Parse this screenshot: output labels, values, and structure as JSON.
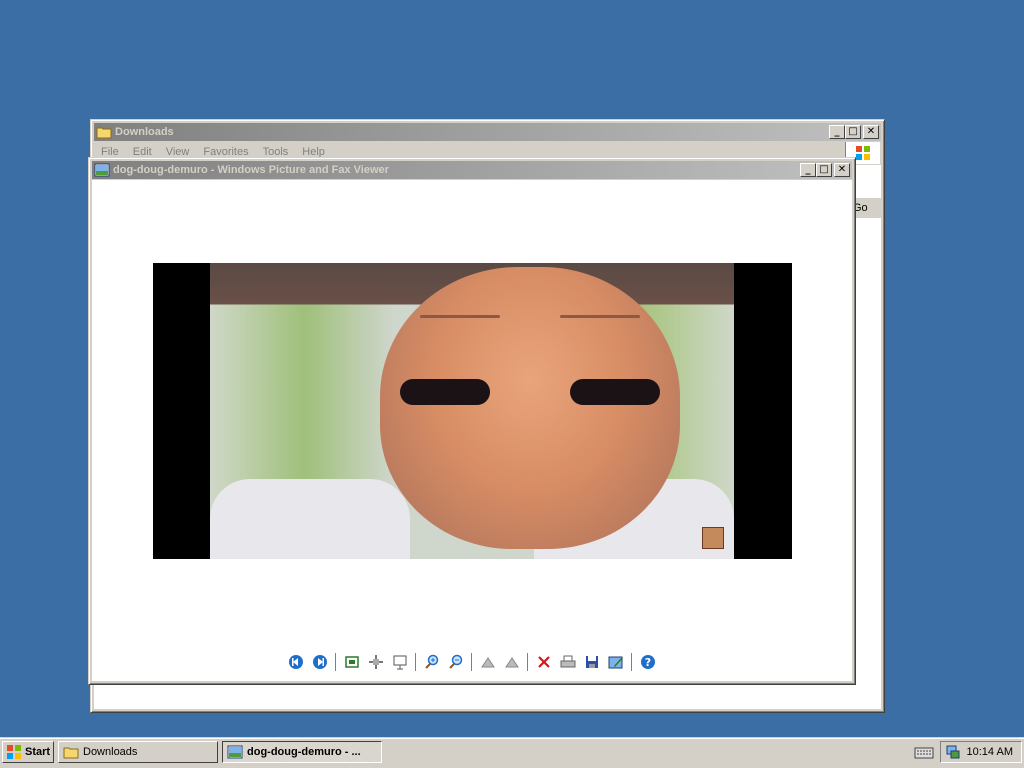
{
  "desktop": {
    "background": "#3a6ea5"
  },
  "downloads_window": {
    "title": "Downloads",
    "menu": [
      "File",
      "Edit",
      "View",
      "Favorites",
      "Tools",
      "Help"
    ],
    "go_label": "Go",
    "icon": "folder-icon"
  },
  "viewer_window": {
    "title": "dog-doug-demuro - Windows Picture and Fax Viewer",
    "icon": "picture-viewer-icon",
    "image_subject": "distorted-face-photo",
    "toolbar": [
      "previous-image-icon",
      "next-image-icon",
      "best-fit-icon",
      "actual-size-icon",
      "slideshow-icon",
      "zoom-in-icon",
      "zoom-out-icon",
      "rotate-clockwise-icon",
      "rotate-counterclockwise-icon",
      "delete-icon",
      "print-icon",
      "save-icon",
      "edit-icon",
      "help-icon"
    ]
  },
  "taskbar": {
    "start_label": "Start",
    "tasks": [
      {
        "label": "Downloads",
        "icon": "folder-icon",
        "active": false
      },
      {
        "label": "dog-doug-demuro - ...",
        "icon": "picture-viewer-icon",
        "active": true
      }
    ],
    "clock": "10:14 AM"
  },
  "colors": {
    "titlebar_inactive": "#808080",
    "taskbar": "#d4d0c8",
    "accent_blue": "#1f6fc8"
  }
}
